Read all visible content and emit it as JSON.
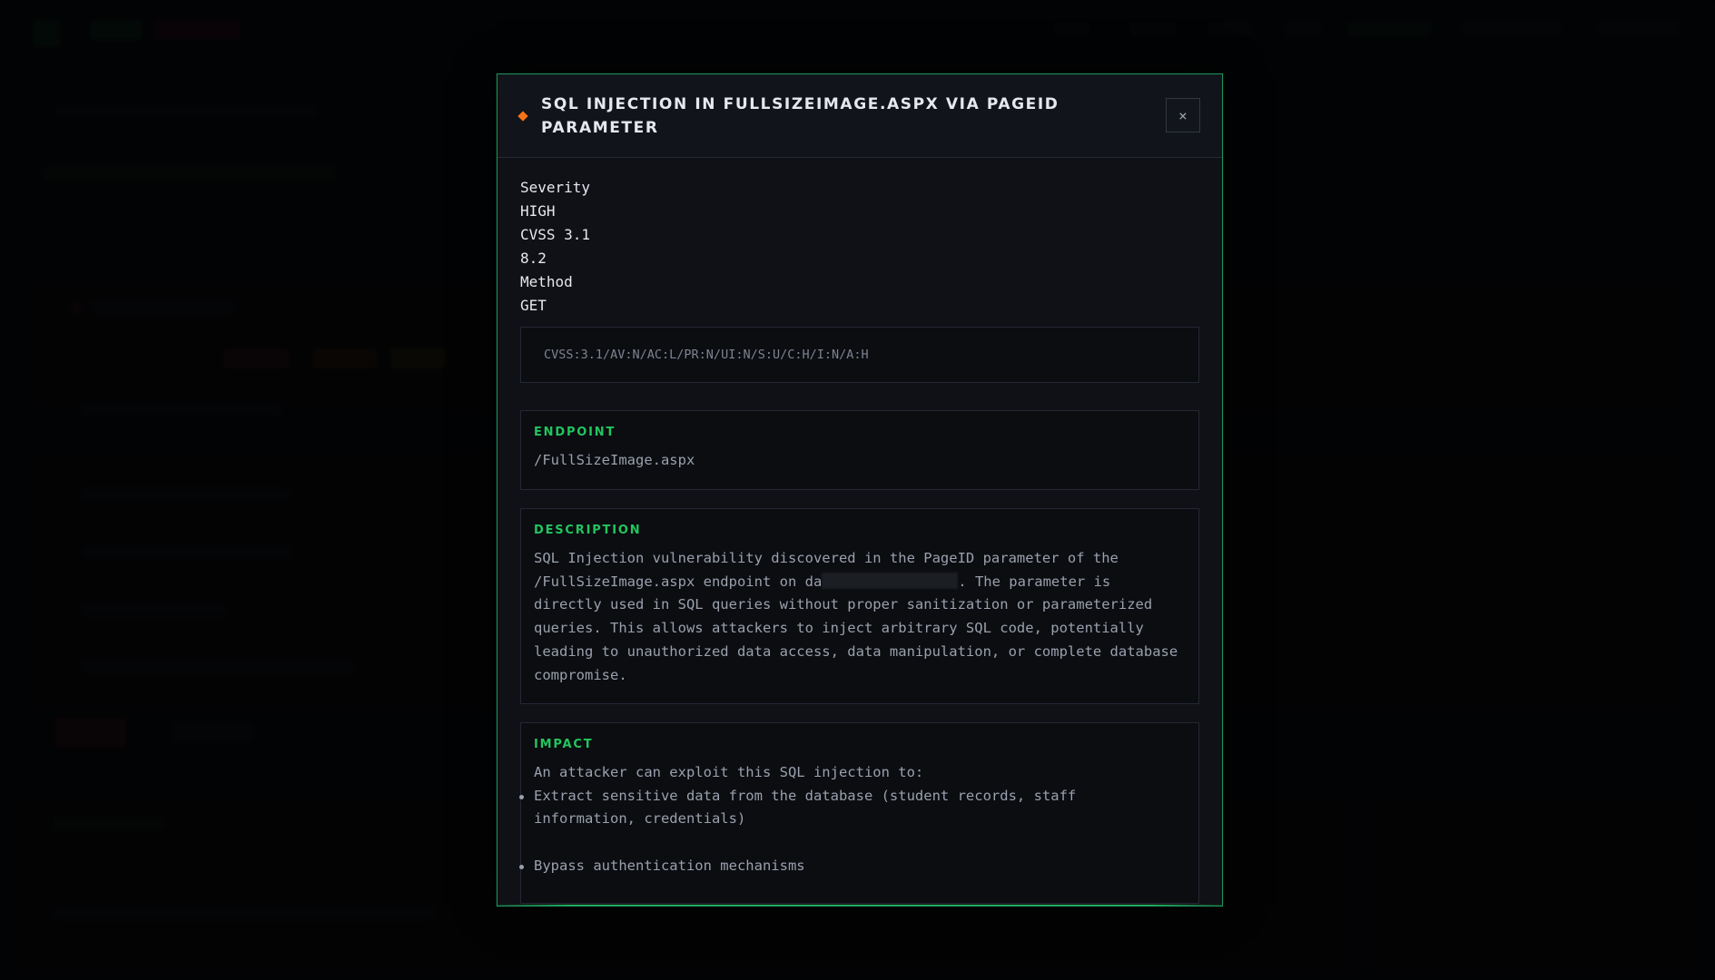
{
  "modal": {
    "title": "SQL Injection in FullSizeImage.aspx via PageID parameter",
    "close_label": "×",
    "meta": {
      "severity_label": "Severity",
      "severity_value": "HIGH",
      "cvss_label": "CVSS 3.1",
      "cvss_value": "8.2",
      "method_label": "Method",
      "method_value": "GET"
    },
    "cvss_vector": "CVSS:3.1/AV:N/AC:L/PR:N/UI:N/S:U/C:H/I:N/A:H",
    "endpoint": {
      "label": "Endpoint",
      "value": "/FullSizeImage.aspx"
    },
    "description": {
      "label": "Description",
      "text_before": "SQL Injection vulnerability discovered in the PageID parameter of the /FullSizeImage.aspx endpoint on da",
      "text_after": ". The parameter is directly used in SQL queries without proper sanitization or parameterized queries. This allows attackers to inject arbitrary SQL code, potentially leading to unauthorized data access, data manipulation, or complete database compromise."
    },
    "impact": {
      "label": "Impact",
      "intro": "An attacker can exploit this SQL injection to:",
      "items": [
        "Extract sensitive data from the database (student records, staff information, credentials)",
        "Bypass authentication mechanisms"
      ]
    }
  },
  "colors": {
    "accent": "#22c55e",
    "severity_marker": "#f97316",
    "modal_bg": "#0f1116",
    "text": "#e6e8ee",
    "muted_text": "#9aa0ad"
  },
  "icons": {
    "title_marker": "diamond-icon",
    "close": "close-icon"
  }
}
